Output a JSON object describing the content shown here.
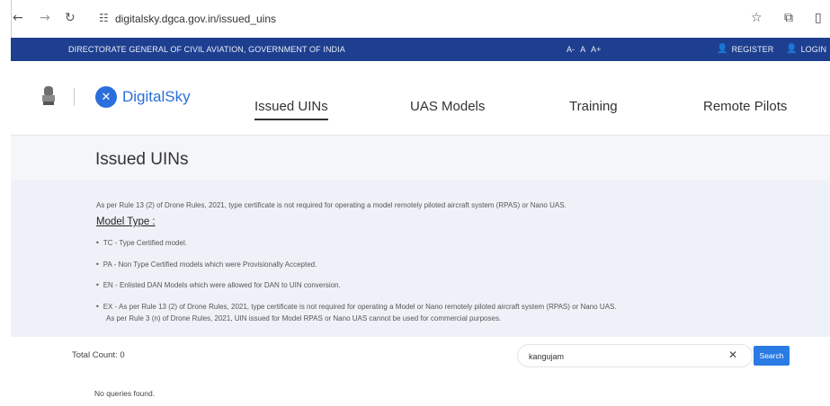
{
  "browser": {
    "url": "digitalsky.dgca.gov.in/issued_uins",
    "back_icon": "arrow-left",
    "forward_icon": "arrow-right",
    "reload_icon": "reload",
    "tune_icon": "tune",
    "star_icon": "star",
    "extension_icon": "puzzle"
  },
  "gov_strip": {
    "title": "DIRECTORATE GENERAL OF CIVIL AVIATION, GOVERNMENT OF INDIA",
    "font_controls": "A- A A+",
    "register_label": "REGISTER",
    "login_label": "LOGIN"
  },
  "header": {
    "brand_name": "DigitalSky",
    "nav": [
      {
        "label": "Issued UINs"
      },
      {
        "label": "UAS Models"
      },
      {
        "label": "Training"
      },
      {
        "label": "Remote Pilots"
      }
    ]
  },
  "page": {
    "title": "Issued UINs"
  },
  "info": {
    "rule_note": "As per Rule 13 (2) of Drone Rules, 2021, type certificate is not required for operating a model remotely piloted aircraft system (RPAS) or Nano UAS.",
    "model_type_heading": "Model Type :",
    "items": [
      {
        "text": "TC - Type Certified model."
      },
      {
        "text": "PA - Non Type Certified models which were Provisionally Accepted."
      },
      {
        "text": "EN - Enlisted DAN Models which were allowed for DAN to UIN conversion."
      },
      {
        "text": "EX - As per Rule 13 (2) of Drone Rules, 2021, type certificate is not required for operating a Model or Nano remotely piloted aircraft system (RPAS) or Nano UAS."
      }
    ],
    "ex_line2": "As per Rule 3 (n) of Drone Rules, 2021, UIN issued for Model RPAS or Nano UAS cannot be used for commercial purposes."
  },
  "results": {
    "total_count": "Total Count: 0",
    "search_value": "kangujam",
    "search_button": "Search",
    "no_results": "No queries found."
  }
}
